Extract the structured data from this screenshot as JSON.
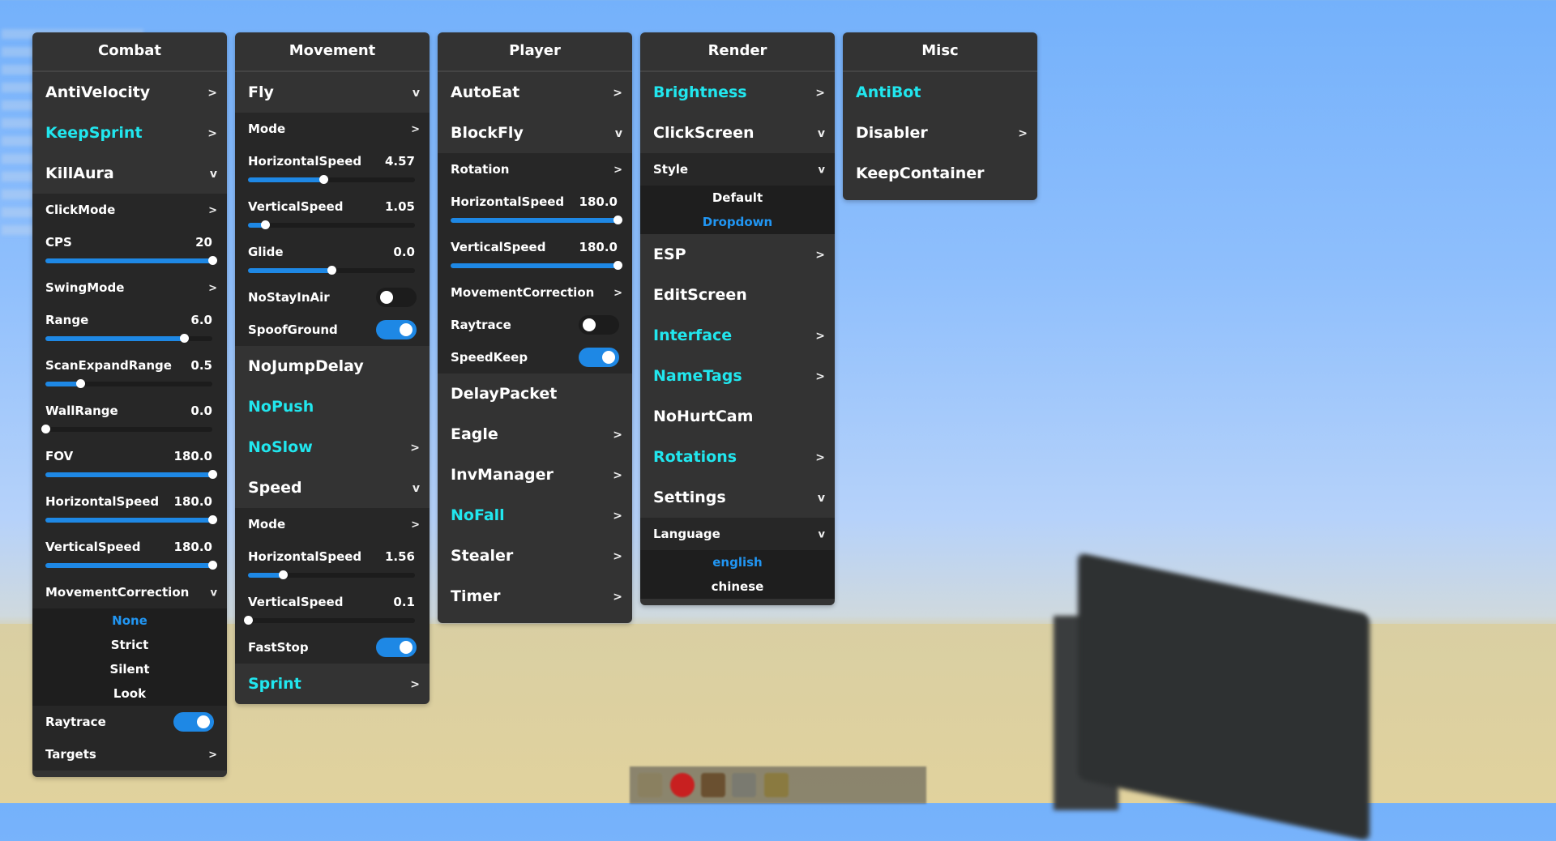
{
  "panels": {
    "combat": {
      "title": "Combat",
      "mods": [
        {
          "name": "AntiVelocity",
          "arrow": ">"
        },
        {
          "name": "KeepSprint",
          "arrow": ">"
        },
        {
          "name": "KillAura",
          "arrow": "v"
        }
      ],
      "killaura": {
        "clickmode": {
          "label": "ClickMode",
          "arrow": ">"
        },
        "cps": {
          "label": "CPS",
          "value": "20",
          "level": 1.0
        },
        "swingmode": {
          "label": "SwingMode",
          "arrow": ">"
        },
        "range": {
          "label": "Range",
          "value": "6.0",
          "level": 0.83
        },
        "scanexpandrange": {
          "label": "ScanExpandRange",
          "value": "0.5",
          "level": 0.21
        },
        "wallrange": {
          "label": "WallRange",
          "value": "0.0",
          "level": 0.0
        },
        "fov": {
          "label": "FOV",
          "value": "180.0",
          "level": 1.0
        },
        "horizontalspeed": {
          "label": "HorizontalSpeed",
          "value": "180.0",
          "level": 1.0
        },
        "verticalspeed": {
          "label": "VerticalSpeed",
          "value": "180.0",
          "level": 1.0
        },
        "movementcorrection": {
          "label": "MovementCorrection",
          "arrow": "v",
          "options": [
            "None",
            "Strict",
            "Silent",
            "Look"
          ]
        },
        "raytrace": {
          "label": "Raytrace"
        },
        "targets": {
          "label": "Targets",
          "arrow": ">"
        }
      }
    },
    "movement": {
      "title": "Movement",
      "fly": {
        "name": "Fly",
        "arrow": "v"
      },
      "fly_settings": {
        "mode": {
          "label": "Mode",
          "arrow": ">"
        },
        "horizontalspeed": {
          "label": "HorizontalSpeed",
          "value": "4.57",
          "level": 0.45
        },
        "verticalspeed": {
          "label": "VerticalSpeed",
          "value": "1.05",
          "level": 0.1
        },
        "glide": {
          "label": "Glide",
          "value": "0.0",
          "level": 0.5
        },
        "nostayinair": {
          "label": "NoStayInAir"
        },
        "spoofground": {
          "label": "SpoofGround"
        }
      },
      "nojumpdelay": {
        "name": "NoJumpDelay"
      },
      "nopush": {
        "name": "NoPush"
      },
      "noslow": {
        "name": "NoSlow",
        "arrow": ">"
      },
      "speed": {
        "name": "Speed",
        "arrow": "v"
      },
      "speed_settings": {
        "mode": {
          "label": "Mode",
          "arrow": ">"
        },
        "horizontalspeed": {
          "label": "HorizontalSpeed",
          "value": "1.56",
          "level": 0.21
        },
        "verticalspeed": {
          "label": "VerticalSpeed",
          "value": "0.1",
          "level": 0.0
        },
        "faststop": {
          "label": "FastStop"
        }
      },
      "sprint": {
        "name": "Sprint",
        "arrow": ">"
      }
    },
    "player": {
      "title": "Player",
      "autoeat": {
        "name": "AutoEat",
        "arrow": ">"
      },
      "blockfly": {
        "name": "BlockFly",
        "arrow": "v"
      },
      "blockfly_settings": {
        "rotation": {
          "label": "Rotation",
          "arrow": ">"
        },
        "horizontalspeed": {
          "label": "HorizontalSpeed",
          "value": "180.0",
          "level": 1.0
        },
        "verticalspeed": {
          "label": "VerticalSpeed",
          "value": "180.0",
          "level": 1.0
        },
        "movementcorrection": {
          "label": "MovementCorrection",
          "arrow": ">"
        },
        "raytrace": {
          "label": "Raytrace"
        },
        "speedkeep": {
          "label": "SpeedKeep"
        }
      },
      "delaypacket": {
        "name": "DelayPacket"
      },
      "eagle": {
        "name": "Eagle",
        "arrow": ">"
      },
      "invmanager": {
        "name": "InvManager",
        "arrow": ">"
      },
      "nofall": {
        "name": "NoFall",
        "arrow": ">"
      },
      "stealer": {
        "name": "Stealer",
        "arrow": ">"
      },
      "timer": {
        "name": "Timer",
        "arrow": ">"
      }
    },
    "render": {
      "title": "Render",
      "brightness": {
        "name": "Brightness",
        "arrow": ">"
      },
      "clickscreen": {
        "name": "ClickScreen",
        "arrow": "v"
      },
      "clickscreen_settings": {
        "style": {
          "label": "Style",
          "arrow": "v",
          "options": [
            "Default",
            "Dropdown"
          ]
        }
      },
      "esp": {
        "name": "ESP",
        "arrow": ">"
      },
      "editscreen": {
        "name": "EditScreen"
      },
      "interface": {
        "name": "Interface",
        "arrow": ">"
      },
      "nametags": {
        "name": "NameTags",
        "arrow": ">"
      },
      "nohurtcam": {
        "name": "NoHurtCam"
      },
      "rotations": {
        "name": "Rotations",
        "arrow": ">"
      },
      "settings": {
        "name": "Settings",
        "arrow": "v"
      },
      "settings_settings": {
        "language": {
          "label": "Language",
          "arrow": "v",
          "options": [
            "english",
            "chinese"
          ]
        }
      }
    },
    "misc": {
      "title": "Misc",
      "antibot": {
        "name": "AntiBot"
      },
      "disabler": {
        "name": "Disabler",
        "arrow": ">"
      },
      "keepcontainer": {
        "name": "KeepContainer"
      }
    }
  },
  "colors": {
    "accent": "#1e88e5",
    "enabled_module": "#21e6ee",
    "panel": "#333333"
  }
}
